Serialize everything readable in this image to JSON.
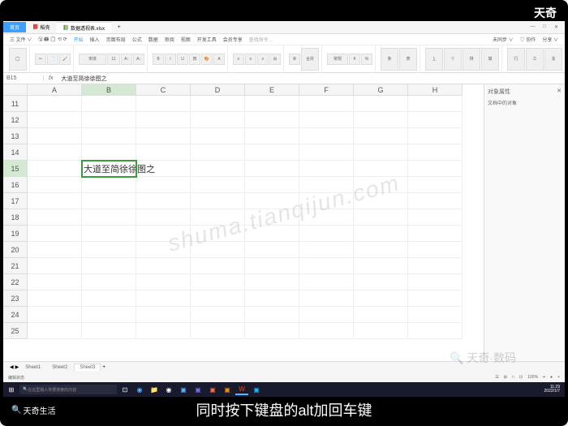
{
  "brand_top": "天奇",
  "title_tabs": {
    "home": "首页",
    "doc": "稻壳",
    "file": "数据透视表.xlsx"
  },
  "menu": {
    "items": [
      "三 文件 ∨",
      "🖫 🖨 📋 ⟲ ⟳",
      "开始",
      "插入",
      "页面布局",
      "公式",
      "数据",
      "审阅",
      "视图",
      "开发工具",
      "会员专享"
    ],
    "search_placeholder": "查找命令...",
    "right": [
      "未同步 ∨",
      "♡ 协作",
      "分享 ∨"
    ]
  },
  "ribbon_groups": [
    [
      "📋",
      "🖌"
    ],
    [
      "✂",
      "📄",
      "格式刷"
    ],
    [
      "宋体",
      "11",
      "A",
      "A"
    ],
    [
      "B",
      "I",
      "U",
      "田",
      "🎨",
      "A"
    ],
    [
      "≡",
      "≡",
      "≡",
      "⊞"
    ],
    [
      "≣",
      "≣",
      "合并"
    ],
    [
      "常规",
      "¥",
      "%"
    ],
    [
      "条件",
      "表格",
      "求和"
    ],
    [
      "∑",
      "▽",
      "填充"
    ],
    [
      "行列",
      "工作表",
      "冻结"
    ],
    [
      "查找",
      "符号"
    ]
  ],
  "formula_bar": {
    "name_box": "B15",
    "formula": "大道至简徐徐图之"
  },
  "columns": [
    "A",
    "B",
    "C",
    "D",
    "E",
    "F",
    "G",
    "H"
  ],
  "rows": [
    11,
    12,
    13,
    14,
    15,
    16,
    17,
    18,
    19,
    20,
    21,
    22,
    23,
    24,
    25
  ],
  "selected_cell": {
    "col": "B",
    "row": 15
  },
  "cell_value": "大道至简徐徐图之",
  "right_panel": {
    "title": "对象属性",
    "sub": "文档中的对象"
  },
  "sheet_tabs": [
    "Sheet1",
    "Sheet2",
    "Sheet3"
  ],
  "active_sheet": 2,
  "status": {
    "left": "编辑状态",
    "right_items": [
      "☰",
      "⊞",
      "□",
      "⊡",
      "100%",
      "━",
      "●",
      "+"
    ]
  },
  "taskbar": {
    "search": "在这里输入你要搜索的内容",
    "time": "11:29",
    "date": "2022/1/7"
  },
  "subtitle": "同时按下键盘的alt加回车键",
  "logo_bottom": "天奇生活",
  "watermark": "shuma.tianqijun.com",
  "watermark2": "天奇·数码"
}
